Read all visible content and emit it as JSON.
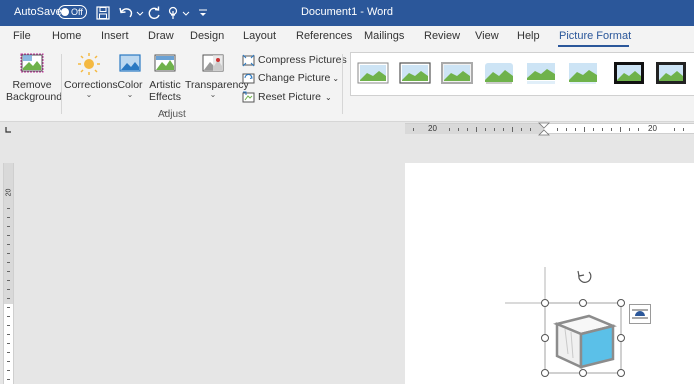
{
  "titlebar": {
    "autosave_label": "AutoSave",
    "autosave_state": "Off",
    "document_title": "Document1 - Word",
    "background_color": "#2b579a",
    "icons": [
      "save-icon",
      "undo-icon",
      "redo-icon",
      "touch-mode-icon",
      "customize-qat-icon"
    ]
  },
  "tabs": [
    {
      "label": "File"
    },
    {
      "label": "Home"
    },
    {
      "label": "Insert"
    },
    {
      "label": "Draw"
    },
    {
      "label": "Design"
    },
    {
      "label": "Layout"
    },
    {
      "label": "References"
    },
    {
      "label": "Mailings"
    },
    {
      "label": "Review"
    },
    {
      "label": "View"
    },
    {
      "label": "Help"
    },
    {
      "label": "Picture Format",
      "active": true
    }
  ],
  "ribbon": {
    "remove_background": {
      "line1": "Remove",
      "line2": "Background"
    },
    "corrections": {
      "label": "Corrections"
    },
    "color": {
      "label": "Color"
    },
    "artistic_effects": {
      "line1": "Artistic",
      "line2": "Effects"
    },
    "transparency": {
      "label": "Transparency"
    },
    "compress_pictures": "Compress Pictures",
    "change_picture": "Change Picture",
    "reset_picture": "Reset Picture",
    "group_label": "Adjust",
    "picture_styles_count": 8
  },
  "rulers": {
    "horizontal_left": "20",
    "horizontal_right": "20",
    "vertical_top": "20"
  },
  "colors": {
    "accent": "#2b579a",
    "canvas": "#e6e6e6",
    "ribbon": "#f3f3f3",
    "cube_face": "#5bc0e8"
  }
}
